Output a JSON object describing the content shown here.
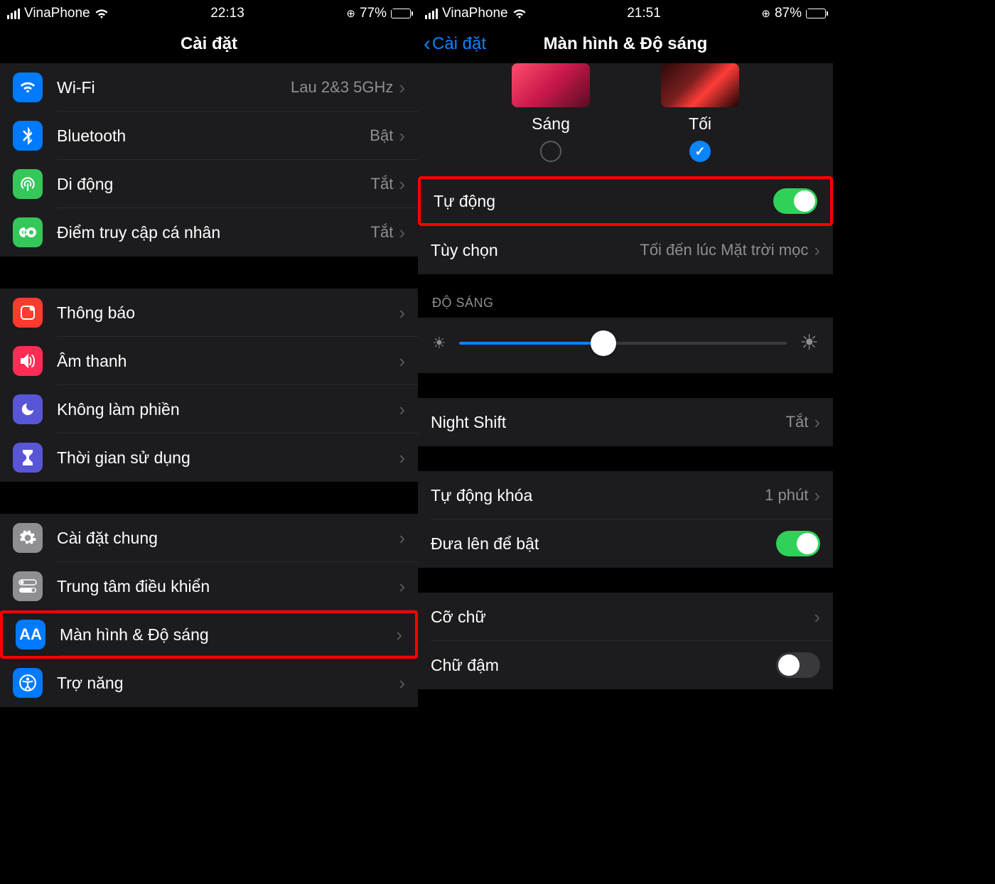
{
  "left": {
    "status": {
      "carrier": "VinaPhone",
      "time": "22:13",
      "battery_pct": "77%"
    },
    "title": "Cài đặt",
    "rows": {
      "wifi": {
        "label": "Wi-Fi",
        "value": "Lau 2&3 5GHz"
      },
      "bluetooth": {
        "label": "Bluetooth",
        "value": "Bật"
      },
      "cellular": {
        "label": "Di động",
        "value": "Tắt"
      },
      "hotspot": {
        "label": "Điểm truy cập cá nhân",
        "value": "Tắt"
      },
      "notif": {
        "label": "Thông báo"
      },
      "sound": {
        "label": "Âm thanh"
      },
      "dnd": {
        "label": "Không làm phiền"
      },
      "screentime": {
        "label": "Thời gian sử dụng"
      },
      "general": {
        "label": "Cài đặt chung"
      },
      "control": {
        "label": "Trung tâm điều khiển"
      },
      "display": {
        "label": "Màn hình & Độ sáng"
      },
      "access": {
        "label": "Trợ năng"
      }
    }
  },
  "right": {
    "status": {
      "carrier": "VinaPhone",
      "time": "21:51",
      "battery_pct": "87%"
    },
    "back": "Cài đặt",
    "title": "Màn hình & Độ sáng",
    "appearance": {
      "light": "Sáng",
      "dark": "Tối"
    },
    "auto": {
      "label": "Tự động"
    },
    "options": {
      "label": "Tùy chọn",
      "value": "Tối đến lúc Mặt trời mọc"
    },
    "brightness_header": "ĐỘ SÁNG",
    "nightshift": {
      "label": "Night Shift",
      "value": "Tắt"
    },
    "autolock": {
      "label": "Tự động khóa",
      "value": "1 phút"
    },
    "raise": {
      "label": "Đưa lên để bật"
    },
    "textsize": {
      "label": "Cỡ chữ"
    },
    "boldtext": {
      "label": "Chữ đậm"
    }
  }
}
